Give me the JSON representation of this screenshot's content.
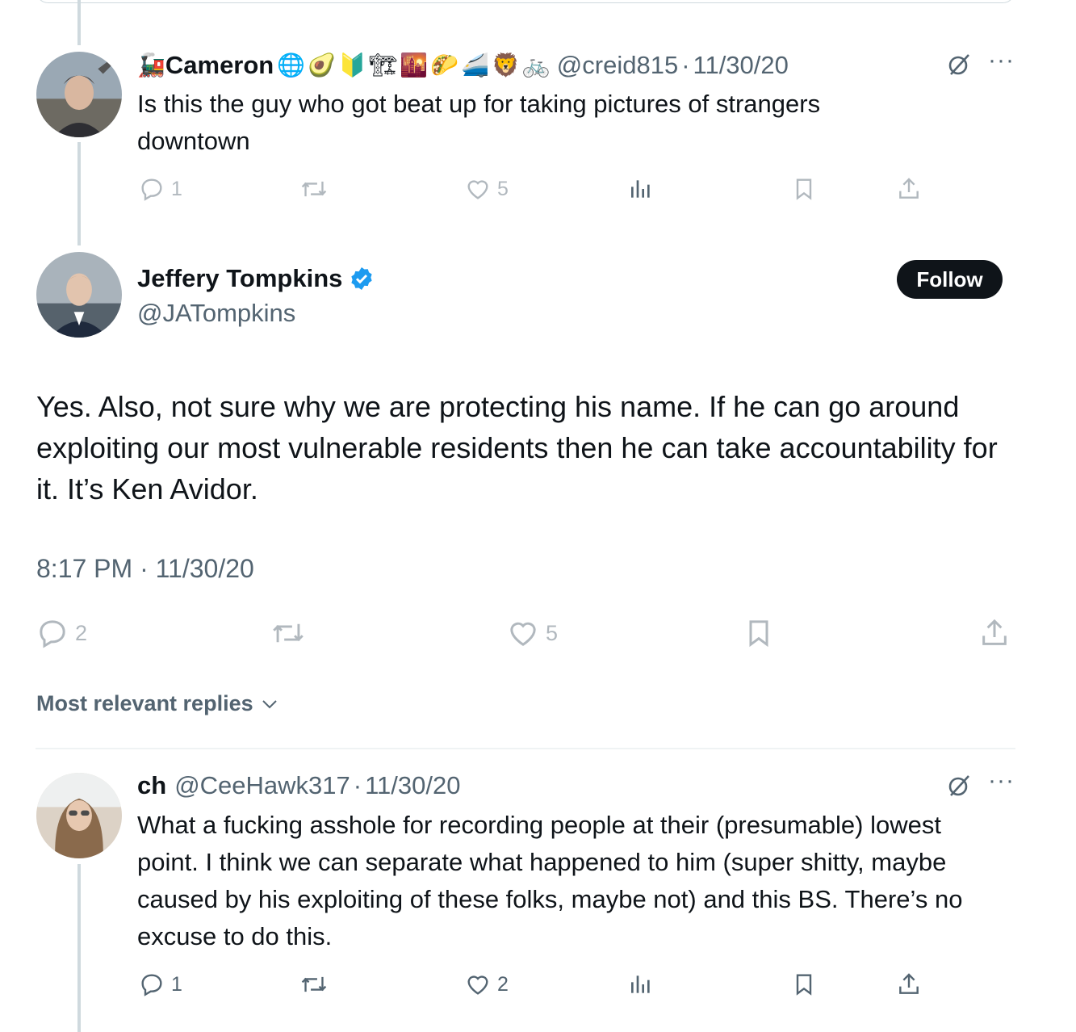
{
  "reply_parent": {
    "author_name": "Cameron",
    "author_emojis": [
      "🚂",
      "🌐",
      "🥑",
      "🔰",
      "🏗",
      "🌇",
      "🌮",
      "🚄",
      "🦁",
      "🚲"
    ],
    "handle": "@creid815",
    "separator": "·",
    "date": "11/30/20",
    "text": "Is this the guy who got beat up for taking pictures of strangers downtown",
    "replies": "1",
    "likes": "5",
    "more_label": "···"
  },
  "main_tweet": {
    "author_name": "Jeffery Tompkins",
    "handle": "@JATompkins",
    "follow_label": "Follow",
    "text": "Yes. Also, not sure why we are protecting his name. If he can go around exploiting our most vulnerable residents then he can take accountability for it. It’s Ken Avidor.",
    "timestamp": "8:17 PM · 11/30/20",
    "replies": "2",
    "likes": "5"
  },
  "replies_section": {
    "label": "Most relevant replies"
  },
  "reply": {
    "author_name": "ch",
    "handle": "@CeeHawk317",
    "separator": "·",
    "date": "11/30/20",
    "text": "What a fucking asshole for recording people at their (presumable) lowest point. I think we can separate what happened to him (super shitty, maybe caused by his exploiting of these folks, maybe not) and this BS. There’s no excuse to do this.",
    "replies": "1",
    "likes": "2",
    "more_label": "···"
  },
  "colors": {
    "text_primary": "#0f1419",
    "text_secondary": "#536471",
    "verified_blue": "#1d9bf0",
    "divider": "#eff3f4",
    "thread_line": "#cfd9de"
  }
}
